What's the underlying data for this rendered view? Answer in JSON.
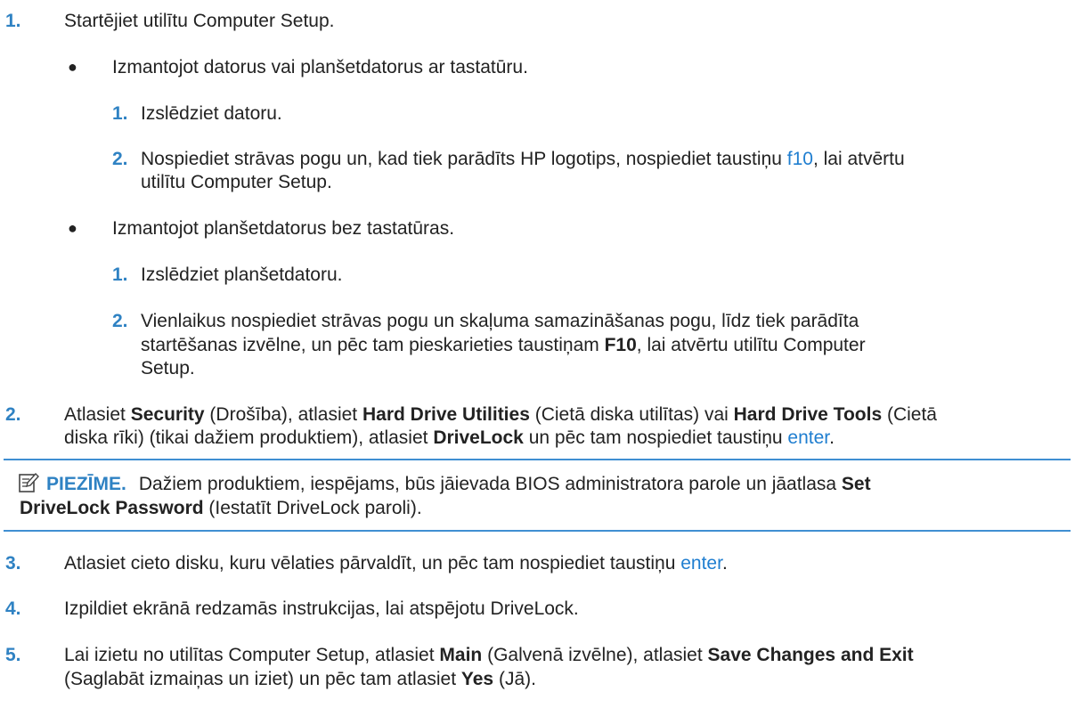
{
  "steps": {
    "s1": {
      "num": "1.",
      "text": "Startējiet utilītu Computer Setup.",
      "bulletA": {
        "text": "Izmantojot datorus vai planšetdatorus ar tastatūru.",
        "sub1": {
          "num": "1.",
          "text": "Izslēdziet datoru."
        },
        "sub2": {
          "num": "2.",
          "t1": "Nospiediet strāvas pogu un, kad tiek parādīts HP logotips, nospiediet taustiņu ",
          "key": "f10",
          "t2": ", lai atvērtu",
          "line2": "utilītu Computer Setup."
        }
      },
      "bulletB": {
        "text": "Izmantojot planšetdatorus bez tastatūras.",
        "sub1": {
          "num": "1.",
          "text": "Izslēdziet planšetdatoru."
        },
        "sub2": {
          "num": "2.",
          "line1": "Vienlaikus nospiediet strāvas pogu un skaļuma samazināšanas pogu, līdz tiek parādīta",
          "l2a": "startēšanas izvēlne, un pēc tam pieskarieties taustiņam ",
          "l2b": "F10",
          "l2c": ", lai atvērtu utilītu Computer",
          "line3": "Setup."
        }
      }
    },
    "s2": {
      "num": "2.",
      "a": "Atlasiet ",
      "b": "Security",
      "c": " (Drošība), atlasiet ",
      "d": "Hard Drive Utilities",
      "e": " (Cietā diska utilītas) vai ",
      "f": "Hard Drive Tools",
      "g": " (Cietā",
      "h": "diska rīki) (tikai dažiem produktiem), atlasiet ",
      "i": "DriveLock",
      "j": " un pēc tam nospiediet taustiņu ",
      "key": "enter",
      "k": "."
    },
    "note": {
      "label": "PIEZĪME.",
      "a": "Dažiem produktiem, iespējams, būs jāievada BIOS administratora parole un jāatlasa ",
      "b": "Set",
      "c": "DriveLock Password",
      "d": " (Iestatīt DriveLock paroli)."
    },
    "s3": {
      "num": "3.",
      "text": "Atlasiet cieto disku, kuru vēlaties pārvaldīt, un pēc tam nospiediet taustiņu ",
      "key": "enter",
      "end": "."
    },
    "s4": {
      "num": "4.",
      "text": "Izpildiet ekrānā redzamās instrukcijas, lai atspējotu DriveLock."
    },
    "s5": {
      "num": "5.",
      "a": "Lai izietu no utilītas Computer Setup, atlasiet ",
      "b": "Main",
      "c": " (Galvenā izvēlne), atlasiet ",
      "d": "Save Changes and Exit",
      "e": "(Saglabāt izmaiņas un iziet) un pēc tam atlasiet ",
      "f": "Yes",
      "g": " (Jā)."
    }
  }
}
